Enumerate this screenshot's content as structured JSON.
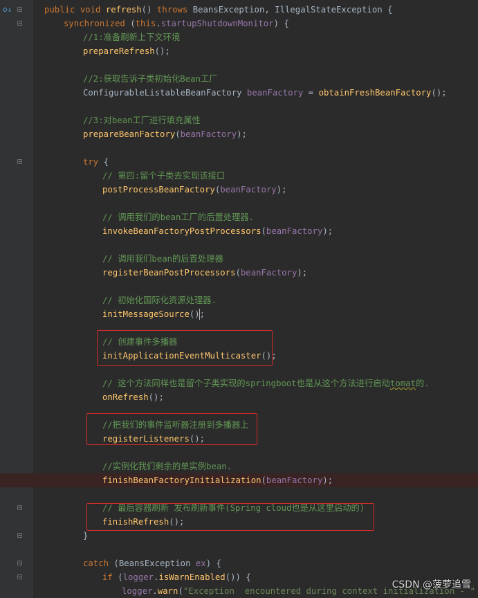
{
  "editor": {
    "lines": [
      [
        {
          "t": "public void ",
          "c": "kw"
        },
        {
          "t": "refresh",
          "c": "m"
        },
        {
          "t": "() ",
          "c": "plain"
        },
        {
          "t": "throws ",
          "c": "kw"
        },
        {
          "t": "BeansException, IllegalStateException {",
          "c": "ty"
        }
      ],
      [
        {
          "t": "synchronized ",
          "c": "kw"
        },
        {
          "t": "(",
          "c": "plain"
        },
        {
          "t": "this",
          "c": "kw"
        },
        {
          "t": ".",
          "c": "plain"
        },
        {
          "t": "startupShutdownMonitor",
          "c": "pv"
        },
        {
          "t": ") {",
          "c": "plain"
        }
      ],
      [
        {
          "t": "//1:准备刷新上下文环境",
          "c": "cm"
        }
      ],
      [
        {
          "t": "prepareRefresh",
          "c": "m"
        },
        {
          "t": "();",
          "c": "plain"
        }
      ],
      [],
      [
        {
          "t": "//2:获取告诉子类初始化Bean工厂",
          "c": "cm"
        }
      ],
      [
        {
          "t": "ConfigurableListableBeanFactory ",
          "c": "ty"
        },
        {
          "t": "beanFactory",
          "c": "pv"
        },
        {
          "t": " = ",
          "c": "plain"
        },
        {
          "t": "obtainFreshBeanFactory",
          "c": "m"
        },
        {
          "t": "();",
          "c": "plain"
        }
      ],
      [],
      [
        {
          "t": "//3:对bean工厂进行填充属性",
          "c": "cm"
        }
      ],
      [
        {
          "t": "prepareBeanFactory",
          "c": "m"
        },
        {
          "t": "(",
          "c": "plain"
        },
        {
          "t": "beanFactory",
          "c": "pv"
        },
        {
          "t": ");",
          "c": "plain"
        }
      ],
      [],
      [
        {
          "t": "try ",
          "c": "kw"
        },
        {
          "t": "{",
          "c": "plain"
        }
      ],
      [
        {
          "t": "// 第四:留个子类去实现该接口",
          "c": "cm"
        }
      ],
      [
        {
          "t": "postProcessBeanFactory",
          "c": "m"
        },
        {
          "t": "(",
          "c": "plain"
        },
        {
          "t": "beanFactory",
          "c": "pv"
        },
        {
          "t": ");",
          "c": "plain"
        }
      ],
      [],
      [
        {
          "t": "// 调用我们的bean工厂的后置处理器.",
          "c": "cm"
        }
      ],
      [
        {
          "t": "invokeBeanFactoryPostProcessors",
          "c": "m"
        },
        {
          "t": "(",
          "c": "plain"
        },
        {
          "t": "beanFactory",
          "c": "pv"
        },
        {
          "t": ");",
          "c": "plain"
        }
      ],
      [],
      [
        {
          "t": "// 调用我们bean的后置处理器",
          "c": "cm"
        }
      ],
      [
        {
          "t": "registerBeanPostProcessors",
          "c": "m"
        },
        {
          "t": "(",
          "c": "plain"
        },
        {
          "t": "beanFactory",
          "c": "pv"
        },
        {
          "t": ");",
          "c": "plain"
        }
      ],
      [],
      [
        {
          "t": "// 初始化国际化资源处理器.",
          "c": "cm"
        }
      ],
      [
        {
          "t": "initMessageSource",
          "c": "m"
        },
        {
          "t": "();",
          "c": "plain"
        }
      ],
      [],
      [
        {
          "t": "// 创建事件多播器",
          "c": "cm"
        }
      ],
      [
        {
          "t": "initApplicationEventMulticaster",
          "c": "m"
        },
        {
          "t": "();",
          "c": "plain"
        }
      ],
      [],
      [
        {
          "t": "// 这个方法同样也是留个子类实现的springboot也是从这个方法进行启动",
          "c": "cm"
        },
        {
          "t": "tomat",
          "c": "cm squig"
        },
        {
          "t": "的.",
          "c": "cm"
        }
      ],
      [
        {
          "t": "onRefresh",
          "c": "m"
        },
        {
          "t": "();",
          "c": "plain"
        }
      ],
      [],
      [
        {
          "t": "//把我们的事件监听器注册到多播器上",
          "c": "cm"
        }
      ],
      [
        {
          "t": "registerListeners",
          "c": "m"
        },
        {
          "t": "();",
          "c": "plain"
        }
      ],
      [],
      [
        {
          "t": "//实例化我们剩余的单实例bean.",
          "c": "cm"
        }
      ],
      [
        {
          "t": "finishBeanFactoryInitialization",
          "c": "m"
        },
        {
          "t": "(",
          "c": "plain"
        },
        {
          "t": "beanFactory",
          "c": "pv"
        },
        {
          "t": ");",
          "c": "plain"
        }
      ],
      [],
      [
        {
          "t": "// 最后容器刷新 发布刷新事件(Spring cloud也是从这里启动的)",
          "c": "cm"
        }
      ],
      [
        {
          "t": "finishRefresh",
          "c": "m"
        },
        {
          "t": "();",
          "c": "plain"
        }
      ],
      [
        {
          "t": "}",
          "c": "plain"
        }
      ],
      [],
      [
        {
          "t": "catch ",
          "c": "kw"
        },
        {
          "t": "(BeansException ",
          "c": "ty"
        },
        {
          "t": "ex",
          "c": "pv"
        },
        {
          "t": ") {",
          "c": "plain"
        }
      ],
      [
        {
          "t": "if ",
          "c": "kw"
        },
        {
          "t": "(",
          "c": "plain"
        },
        {
          "t": "logger",
          "c": "pv"
        },
        {
          "t": ".",
          "c": "plain"
        },
        {
          "t": "isWarnEnabled",
          "c": "m"
        },
        {
          "t": "()) {",
          "c": "plain"
        }
      ],
      [
        {
          "t": "logger",
          "c": "pv"
        },
        {
          "t": ".",
          "c": "plain"
        },
        {
          "t": "warn",
          "c": "m"
        },
        {
          "t": "(",
          "c": "plain"
        },
        {
          "t": "\"Exception  encountered during context initialization - \"",
          "c": "str"
        }
      ]
    ]
  },
  "watermark": "CSDN @菠萝追雪"
}
